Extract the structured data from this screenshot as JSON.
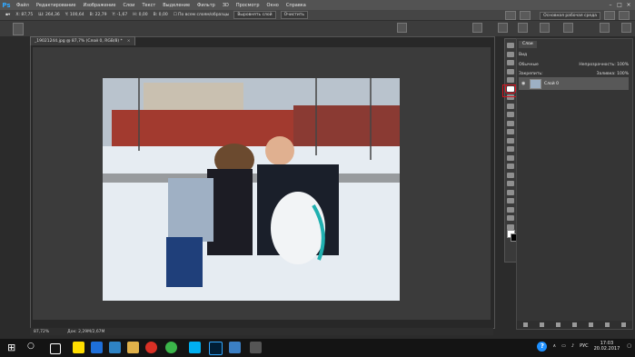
{
  "menu": {
    "logo": "Ps",
    "items": [
      "Файл",
      "Редактирование",
      "Изображение",
      "Слои",
      "Текст",
      "Выделение",
      "Фильтр",
      "3D",
      "Просмотр",
      "Окно",
      "Справка"
    ]
  },
  "options": {
    "x": "X: 87,75",
    "w": "Ш: 264,36",
    "y": "Y: 100,64",
    "h": "В: 22,79",
    "angle": "Y: -1,67",
    "h2": "Н: 0,00",
    "v2": "В: 0,00",
    "checkbox_label": "По всем слоям/образцы",
    "align_button": "Выровнять слой",
    "clear_button": "Очистить",
    "workspace": "Основная рабочая среда"
  },
  "document": {
    "tab_title": "_19021244.jpg @ 87,7% (Слой 0, RGB/8) *",
    "close": "×",
    "zoom": "87,72%",
    "doc_info": "Док: 2,29М/2,67М"
  },
  "layers_panel": {
    "tab": "Слои",
    "kind": "Вид",
    "blend_mode": "Обычные",
    "opacity_label": "Непрозрачность: 100%",
    "lock_label": "Закрепить:",
    "fill_label": "Заливка: 100%",
    "layer_name": "Слой 0"
  },
  "taskbar": {
    "lang": "РУС",
    "time": "17:03",
    "date": "20.02.2017",
    "help": "?"
  }
}
